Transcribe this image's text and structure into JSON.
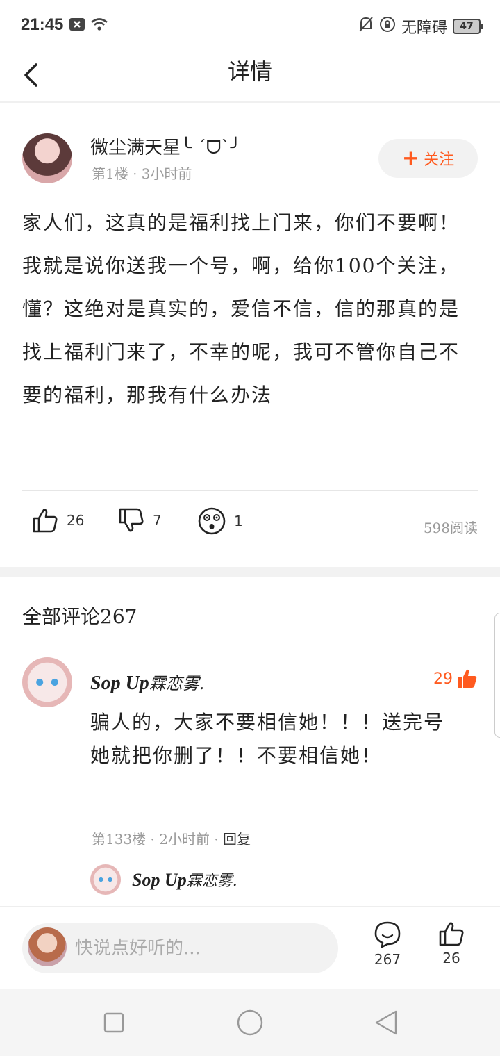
{
  "status_bar": {
    "time": "21:45",
    "accessibility": "无障碍",
    "battery": "47"
  },
  "header": {
    "title": "详情"
  },
  "post": {
    "author": "微尘满天星╰ ˊᗜˋ╯",
    "meta": "第1楼 · 3小时前",
    "follow_label": "关注",
    "body": "家人们，这真的是福利找上门来，你们不要啊！我就是说你送我一个号，啊，给你100个关注，懂？这绝对是真实的，爱信不信，信的那真的是找上福利门来了，不幸的呢，我可不管你自己不要的福利，那我有什么办法",
    "likes": "26",
    "dislikes": "7",
    "wow": "1",
    "reads": "598阅读"
  },
  "comments": {
    "header": "全部评论267",
    "items": [
      {
        "author_latin": "Sop Up",
        "author_cn": "霖恋雾.",
        "likes": "29",
        "body": "骗人的，大家不要相信她！！！送完号她就把你删了！！不要相信她！",
        "meta": "第133楼 · 2小时前 · ",
        "reply_label": "回复",
        "reply_author_latin": "Sop Up",
        "reply_author_cn": "霖恋雾."
      }
    ]
  },
  "bottom_bar": {
    "placeholder": "快说点好听的...",
    "comment_count": "267",
    "like_count": "26"
  },
  "colors": {
    "accent": "#ff5a1f",
    "muted": "#999999"
  }
}
